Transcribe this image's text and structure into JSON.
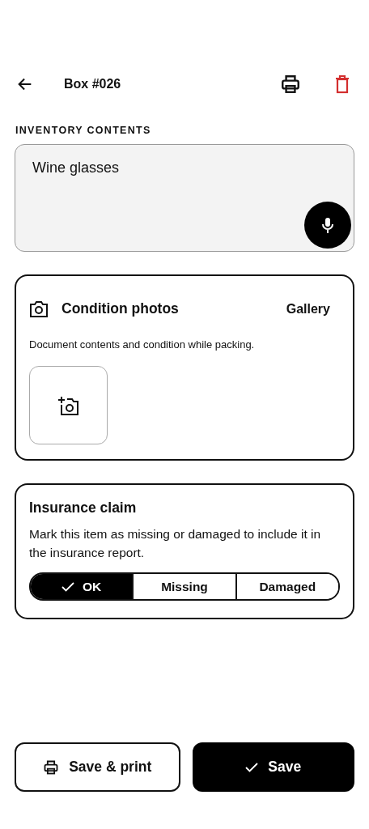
{
  "header": {
    "title": "Box #026"
  },
  "contents": {
    "label": "INVENTORY CONTENTS",
    "value": "Wine glasses"
  },
  "photos": {
    "title": "Condition photos",
    "gallery": "Gallery",
    "description": "Document contents and condition while packing."
  },
  "claim": {
    "title": "Insurance claim",
    "description": "Mark this item as missing or damaged to include it in the insurance report.",
    "options": [
      {
        "label": "OK",
        "selected": true
      },
      {
        "label": "Missing",
        "selected": false
      },
      {
        "label": "Damaged",
        "selected": false
      }
    ]
  },
  "actions": [
    {
      "label": "Save & print",
      "kind": "print"
    },
    {
      "label": "Save",
      "kind": "save"
    }
  ]
}
